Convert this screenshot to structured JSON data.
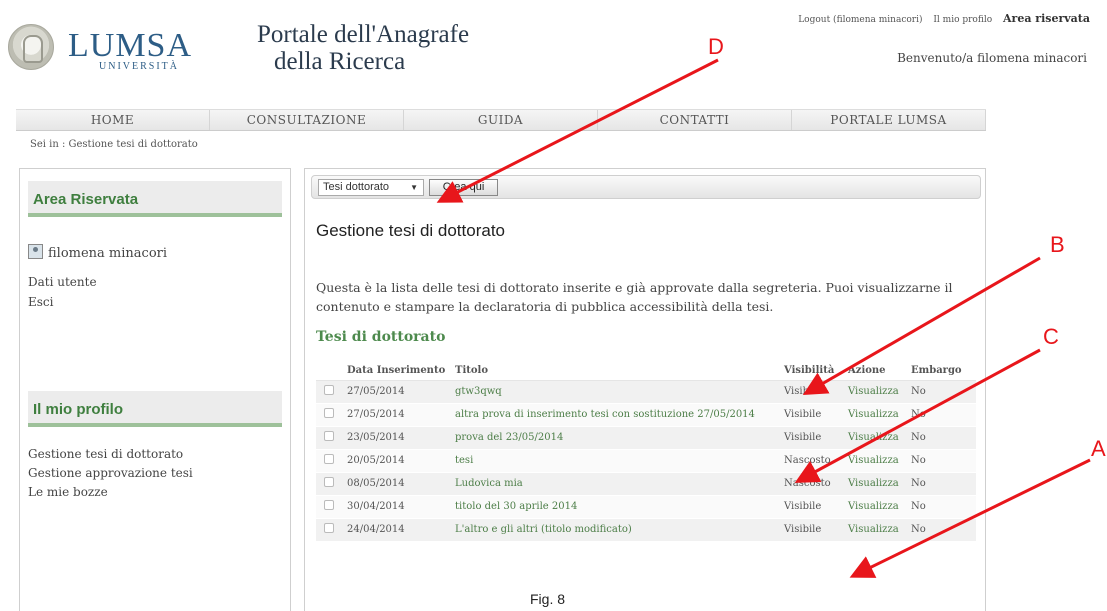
{
  "header": {
    "logo_word": "LUMSA",
    "logo_sub": "UNIVERSITÀ",
    "portal_title_line1": "Portale dell'Anagrafe",
    "portal_title_line2": "della Ricerca",
    "logout_link": "Logout (filomena minacori)",
    "profile_link": "Il mio profilo",
    "reserved_link": "Area riservata",
    "welcome": "Benvenuto/a filomena minacori"
  },
  "nav": {
    "items": [
      "HOME",
      "CONSULTAZIONE",
      "GUIDA",
      "CONTATTI",
      "PORTALE LUMSA"
    ]
  },
  "breadcrumb": "Sei in : Gestione tesi di dottorato",
  "sidebar": {
    "section1_title": "Area Riservata",
    "user_name": "filomena minacori",
    "links1": [
      "Dati utente",
      "Esci"
    ],
    "section2_title": "Il mio profilo",
    "links2": [
      "Gestione tesi di dottorato",
      "Gestione approvazione tesi",
      "Le mie bozze"
    ]
  },
  "main": {
    "select_value": "Tesi dottorato",
    "create_button": "Crea qui",
    "page_title": "Gestione tesi di dottorato",
    "intro": "Questa è la lista delle tesi di dottorato inserite e già approvate dalla segreteria. Puoi visualizzarne il contenuto e stampare la declaratoria di pubblica accessibilità della tesi.",
    "section_title": "Tesi di dottorato",
    "table": {
      "headers": [
        "Data Inserimento",
        "Titolo",
        "Visibilità",
        "Azione",
        "Embargo"
      ],
      "rows": [
        {
          "date": "27/05/2014",
          "title": "gtw3qwq",
          "visibility": "Visibile",
          "action": "Visualizza",
          "embargo": "No"
        },
        {
          "date": "27/05/2014",
          "title": "altra prova di inserimento tesi con sostituzione 27/05/2014",
          "visibility": "Visibile",
          "action": "Visualizza",
          "embargo": "No"
        },
        {
          "date": "23/05/2014",
          "title": "prova del 23/05/2014",
          "visibility": "Visibile",
          "action": "Visualizza",
          "embargo": "No"
        },
        {
          "date": "20/05/2014",
          "title": "tesi",
          "visibility": "Nascosto",
          "action": "Visualizza",
          "embargo": "No"
        },
        {
          "date": "08/05/2014",
          "title": "Ludovica mia",
          "visibility": "Nascosto",
          "action": "Visualizza",
          "embargo": "No"
        },
        {
          "date": "30/04/2014",
          "title": "titolo del 30 aprile 2014",
          "visibility": "Visibile",
          "action": "Visualizza",
          "embargo": "No"
        },
        {
          "date": "24/04/2014",
          "title": "L'altro e gli altri (titolo modificato)",
          "visibility": "Visibile",
          "action": "Visualizza",
          "embargo": "No"
        }
      ]
    }
  },
  "annotations": {
    "labels": [
      "D",
      "B",
      "C",
      "A"
    ],
    "color": "#e8161b"
  },
  "caption": "Fig. 8"
}
